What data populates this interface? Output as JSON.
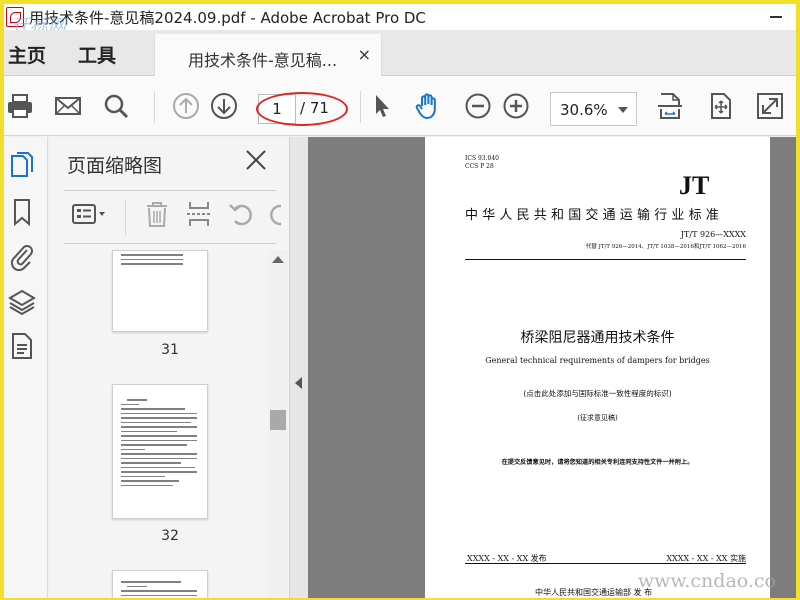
{
  "window": {
    "title": "用技术条件-意见稿2024.09.pdf - Adobe Acrobat Pro DC"
  },
  "watermarks": {
    "top_left": "迁标网",
    "bottom_right": "www.cndao.co"
  },
  "menu": {
    "home": "主页",
    "tools": "工具"
  },
  "doc_tab": {
    "label": "用技术条件-意见稿...",
    "close": "×"
  },
  "toolbar": {
    "icons": [
      "print-icon",
      "email-icon",
      "search-icon",
      "prev-page-icon",
      "next-page-icon",
      "select-arrow-icon",
      "hand-tool-icon",
      "zoom-out-icon",
      "zoom-in-icon",
      "fit-page-icon",
      "rotate-view-icon",
      "fullscreen-icon"
    ],
    "page_current": "1",
    "page_total": "/ 71",
    "zoom": "30.6%",
    "highlight_color": "#e0242a"
  },
  "leftstrip": {
    "icons": [
      "page-thumbnails-icon",
      "bookmarks-icon",
      "attachments-icon",
      "layers-icon",
      "document-info-icon"
    ]
  },
  "thumbnails_panel": {
    "title": "页面缩略图",
    "close": "×",
    "tools": [
      "thumbnail-options-icon",
      "delete-icon",
      "insert-page-icon",
      "undo-icon"
    ],
    "pages": [
      {
        "number": "31"
      },
      {
        "number": "32"
      }
    ]
  },
  "document": {
    "ics_line1": "ICS 93.040",
    "ics_line2": "CCS P 28",
    "logo": "JT",
    "standard_title": "中华人民共和国交通运输行业标准",
    "code": "JT/T 926—XXXX",
    "replaces": "代替 JT/T 926—2014、JT/T 1038—2016和JT/T 1062—2016",
    "title_cn": "桥梁阻尼器通用技术条件",
    "title_en": "General technical requirements of dampers for bridges",
    "intl_note": "(点击此处添加与国际标准一致性程度的标识)",
    "draft": "(征求意见稿)",
    "notice": "在提交反馈意见时，请将您知道的相关专利连同支持性文件一并附上。",
    "publish_date": "XXXX - XX - XX 发布",
    "implement_date": "XXXX - XX - XX 实施",
    "issuer": "中华人民共和国交通运输部    发 布"
  }
}
